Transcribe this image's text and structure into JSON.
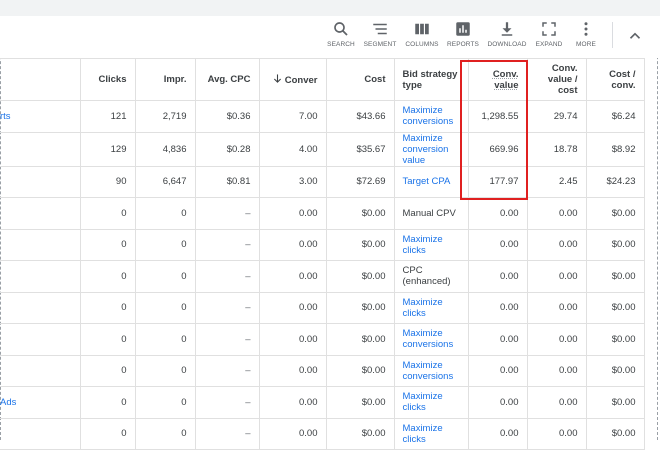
{
  "toolbar": {
    "search": "SEARCH",
    "segment": "SEGMENT",
    "columns": "COLUMNS",
    "reports": "REPORTS",
    "download": "DOWNLOAD",
    "expand": "EXPAND",
    "more": "MORE"
  },
  "table": {
    "headers": {
      "first": "",
      "clicks": "Clicks",
      "impr": "Impr.",
      "avg_cpc": "Avg. CPC",
      "conversions": "Conver",
      "cost": "Cost",
      "bid_strategy": "Bid strategy type",
      "conv_value": "Conv. value",
      "conv_value_cost": "Conv. value / cost",
      "cost_conv": "Cost / conv."
    },
    "rows": [
      {
        "name": "rts",
        "clicks": "121",
        "impr": "2,719",
        "avg_cpc": "$0.36",
        "conv": "7.00",
        "cost": "$43.66",
        "bid": "Maximize conversions",
        "bid_link": true,
        "conv_value": "1,298.55",
        "cvc": "29.74",
        "cost_conv": "$6.24"
      },
      {
        "name": "",
        "clicks": "129",
        "impr": "4,836",
        "avg_cpc": "$0.28",
        "conv": "4.00",
        "cost": "$35.67",
        "bid": "Maximize conversion value",
        "bid_link": true,
        "conv_value": "669.96",
        "cvc": "18.78",
        "cost_conv": "$8.92"
      },
      {
        "name": "",
        "clicks": "90",
        "impr": "6,647",
        "avg_cpc": "$0.81",
        "conv": "3.00",
        "cost": "$72.69",
        "bid": "Target CPA",
        "bid_link": true,
        "conv_value": "177.97",
        "cvc": "2.45",
        "cost_conv": "$24.23"
      },
      {
        "name": "",
        "clicks": "0",
        "impr": "0",
        "avg_cpc": "–",
        "conv": "0.00",
        "cost": "$0.00",
        "bid": "Manual CPV",
        "bid_link": false,
        "conv_value": "0.00",
        "cvc": "0.00",
        "cost_conv": "$0.00"
      },
      {
        "name": "",
        "clicks": "0",
        "impr": "0",
        "avg_cpc": "–",
        "conv": "0.00",
        "cost": "$0.00",
        "bid": "Maximize clicks",
        "bid_link": true,
        "conv_value": "0.00",
        "cvc": "0.00",
        "cost_conv": "$0.00"
      },
      {
        "name": "",
        "clicks": "0",
        "impr": "0",
        "avg_cpc": "–",
        "conv": "0.00",
        "cost": "$0.00",
        "bid": "CPC (enhanced)",
        "bid_link": false,
        "conv_value": "0.00",
        "cvc": "0.00",
        "cost_conv": "$0.00"
      },
      {
        "name": "",
        "clicks": "0",
        "impr": "0",
        "avg_cpc": "–",
        "conv": "0.00",
        "cost": "$0.00",
        "bid": "Maximize clicks",
        "bid_link": true,
        "conv_value": "0.00",
        "cvc": "0.00",
        "cost_conv": "$0.00"
      },
      {
        "name": "",
        "clicks": "0",
        "impr": "0",
        "avg_cpc": "–",
        "conv": "0.00",
        "cost": "$0.00",
        "bid": "Maximize conversions",
        "bid_link": true,
        "conv_value": "0.00",
        "cvc": "0.00",
        "cost_conv": "$0.00"
      },
      {
        "name": "",
        "clicks": "0",
        "impr": "0",
        "avg_cpc": "–",
        "conv": "0.00",
        "cost": "$0.00",
        "bid": "Maximize conversions",
        "bid_link": true,
        "conv_value": "0.00",
        "cvc": "0.00",
        "cost_conv": "$0.00"
      },
      {
        "name": "Ads",
        "clicks": "0",
        "impr": "0",
        "avg_cpc": "–",
        "conv": "0.00",
        "cost": "$0.00",
        "bid": "Maximize clicks",
        "bid_link": true,
        "conv_value": "0.00",
        "cvc": "0.00",
        "cost_conv": "$0.00"
      },
      {
        "name": "",
        "clicks": "0",
        "impr": "0",
        "avg_cpc": "–",
        "conv": "0.00",
        "cost": "$0.00",
        "bid": "Maximize clicks",
        "bid_link": true,
        "conv_value": "0.00",
        "cvc": "0.00",
        "cost_conv": "$0.00"
      }
    ]
  },
  "colors": {
    "link": "#1a73e8",
    "highlight": "#e02020",
    "icon": "#5f6368"
  }
}
